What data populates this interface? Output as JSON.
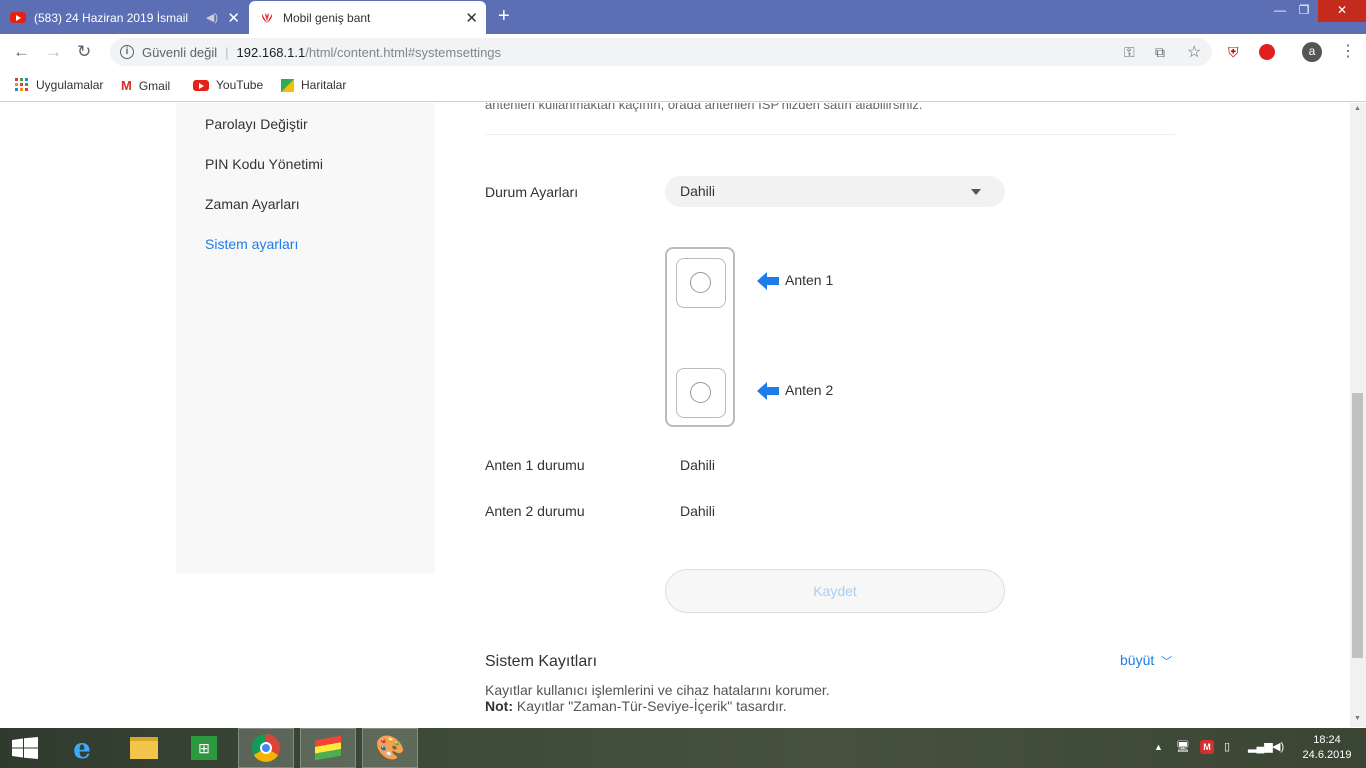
{
  "browser": {
    "tabs": [
      {
        "title": "(583) 24 Haziran 2019 İsmail",
        "active": false
      },
      {
        "title": "Mobil geniş bant",
        "active": true
      }
    ],
    "security_label": "Güvenli değil",
    "url_host": "192.168.1.1",
    "url_path": "/html/content.html#systemsettings",
    "bookmarks": [
      "Uygulamalar",
      "Gmail",
      "YouTube",
      "Haritalar"
    ],
    "profile_initial": "a"
  },
  "sidebar": {
    "items": [
      {
        "label": "Parolayı Değiştir",
        "active": false
      },
      {
        "label": "PIN Kodu Yönetimi",
        "active": false
      },
      {
        "label": "Zaman Ayarları",
        "active": false
      },
      {
        "label": "Sistem ayarları",
        "active": true
      }
    ]
  },
  "main": {
    "truncated_text": "antenleri kullanmaktan kaçının, orada antenleri ISP'nizden satın alabilirsiniz.",
    "status_settings_label": "Durum Ayarları",
    "status_settings_value": "Dahili",
    "antenna1_label": "Anten 1",
    "antenna2_label": "Anten 2",
    "antenna1_status_label": "Anten 1 durumu",
    "antenna1_status_value": "Dahili",
    "antenna2_status_label": "Anten 2 durumu",
    "antenna2_status_value": "Dahili",
    "save_label": "Kaydet",
    "logs_title": "Sistem Kayıtları",
    "expand_label": "büyüt",
    "logs_desc": "Kayıtlar kullanıcı işlemlerini ve cihaz hatalarını korumer.",
    "note_label": "Not:",
    "note_text": "Kayıtlar \"Zaman-Tür-Seviye-İçerik\" tasardır."
  },
  "taskbar": {
    "clock_time": "18:24",
    "clock_date": "24.6.2019"
  },
  "colors": {
    "chrome_frame": "#5c6fb5",
    "accent": "#1e7ce8",
    "save_text": "#a8cff5"
  }
}
